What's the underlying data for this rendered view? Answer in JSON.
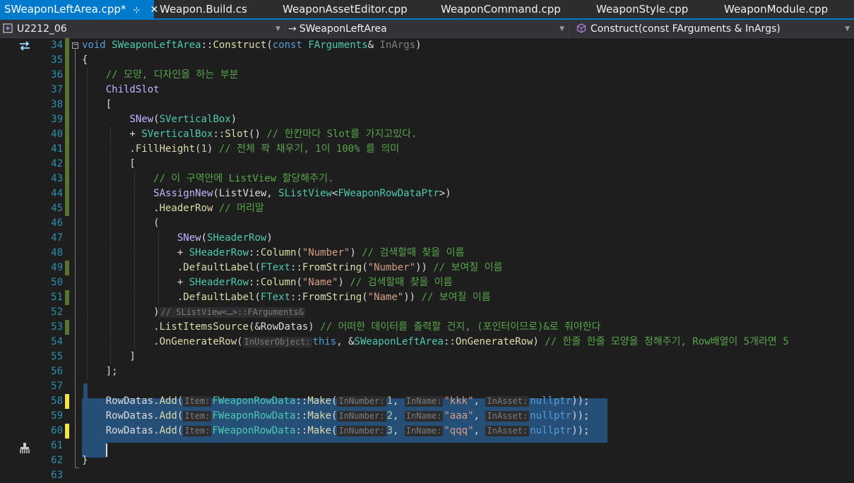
{
  "tabs": [
    {
      "label": "SWeaponLeftArea.cpp*",
      "pin": "⊹",
      "close": "✕"
    },
    {
      "label": "Weapon.Build.cs"
    },
    {
      "label": "WeaponAssetEditor.cpp"
    },
    {
      "label": "WeaponCommand.cpp"
    },
    {
      "label": "WeaponStyle.cpp"
    },
    {
      "label": "WeaponModule.cpp"
    }
  ],
  "navbar": {
    "project": "U2212_06",
    "scope": "SWeaponLeftArea",
    "member": "Construct(const FArguments & InArgs)",
    "arrow": "→",
    "caret": "▼"
  },
  "editor": {
    "line_numbers": [
      "34",
      "35",
      "36",
      "37",
      "38",
      "39",
      "40",
      "41",
      "42",
      "43",
      "44",
      "45",
      "46",
      "47",
      "48",
      "49",
      "50",
      "51",
      "52",
      "53",
      "54",
      "55",
      "56",
      "57",
      "58",
      "59",
      "60",
      "61",
      "62",
      "63"
    ],
    "lines": [
      "void SWeaponLeftArea::Construct(const FArguments& InArgs)",
      "{",
      "    // 모양, 디자인을 하는 부분",
      "    ChildSlot",
      "    [",
      "        SNew(SVerticalBox)",
      "        + SVerticalBox::Slot() // 한칸마다 Slot를 가지고있다.",
      "        .FillHeight(1) // 전체 꽉 채우기, 1이 100% 를 의미",
      "        [",
      "            // 이 구역안에 ListView 할당해주기.",
      "            SAssignNew(ListView, SListView<FWeaponRowDataPtr>)",
      "            .HeaderRow // 머리말",
      "            (",
      "                SNew(SHeaderRow)",
      "                + SHeaderRow::Column(\"Number\") // 검색할때 찾을 이름",
      "                .DefaultLabel(FText::FromString(\"Number\")) // 보여질 이름",
      "                + SHeaderRow::Column(\"Name\") // 검색할때 찾을 이름",
      "                .DefaultLabel(FText::FromString(\"Name\")) // 보여질 이름",
      "            )// SListView<…>::FArguments&",
      "            .ListItemsSource(&RowDatas) // 어떠한 데이터를 출력할 건지, (포인터이므로)&로 줘야한다",
      "            .OnGenerateRow( InUserObject: this, &SWeaponLeftArea::OnGenerateRow) // 한줄 한줄 모양을 정해주기, Row배열이 5개라면 5",
      "        ]",
      "    ];",
      "",
      "    RowDatas.Add( Item: FWeaponRowData::Make( InNumber: 1,  InName: \"kkk\",  InAsset: nullptr));",
      "    RowDatas.Add( Item: FWeaponRowData::Make( InNumber: 2,  InName: \"aaa\",  InAsset: nullptr));",
      "    RowDatas.Add( Item: FWeaponRowData::Make( InNumber: 3,  InName: \"qqq\",  InAsset: nullptr));",
      "",
      "}",
      ""
    ],
    "hints": {
      "fargs": "// SListView<…>::FArguments&",
      "in_user_object": "InUserObject:",
      "item": "Item:",
      "in_number": "InNumber:",
      "in_name": "InName:",
      "in_asset": "InAsset:"
    }
  },
  "colors": {
    "background": "#1e1e1e",
    "accent": "#007acc",
    "line_number": "#2b91af",
    "keyword": "#569cd6",
    "type": "#4ec9b0",
    "function": "#dcdcaa",
    "macro": "#beb7ff",
    "string": "#d69d85",
    "comment": "#57a64a",
    "selection": "#264f78",
    "change_saved": "#577430",
    "change_unsaved": "#efe34c"
  },
  "icons": {
    "glyph_line34": "sync-arrows-icon",
    "glyph_line61": "brush-icon"
  }
}
